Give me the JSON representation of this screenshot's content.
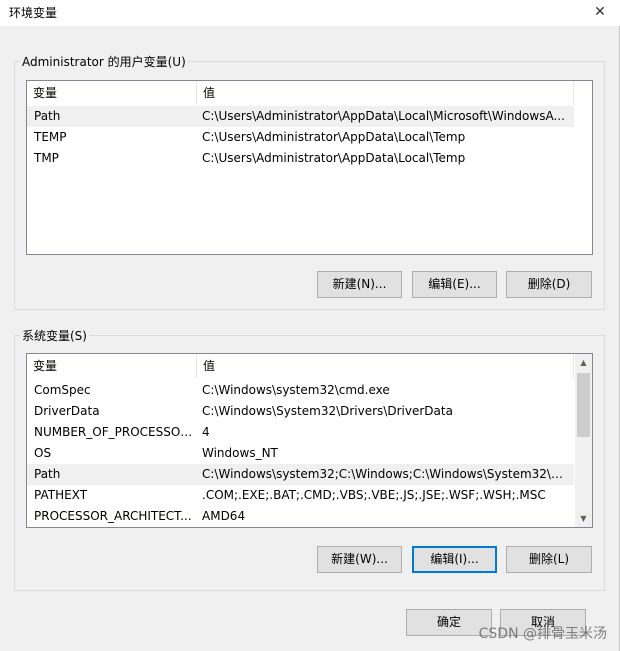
{
  "window": {
    "title": "环境变量",
    "close_glyph": "✕"
  },
  "user_vars": {
    "group_label": "Administrator 的用户变量(U)",
    "columns": [
      "变量",
      "值"
    ],
    "rows": [
      {
        "name": "Path",
        "value": "C:\\Users\\Administrator\\AppData\\Local\\Microsoft\\WindowsA..."
      },
      {
        "name": "TEMP",
        "value": "C:\\Users\\Administrator\\AppData\\Local\\Temp"
      },
      {
        "name": "TMP",
        "value": "C:\\Users\\Administrator\\AppData\\Local\\Temp"
      }
    ],
    "selected_row": "Path",
    "buttons": {
      "new": "新建(N)...",
      "edit": "编辑(E)...",
      "delete": "删除(D)"
    }
  },
  "system_vars": {
    "group_label": "系统变量(S)",
    "columns": [
      "变量",
      "值"
    ],
    "rows": [
      {
        "name": "ComSpec",
        "value": "C:\\Windows\\system32\\cmd.exe"
      },
      {
        "name": "DriverData",
        "value": "C:\\Windows\\System32\\Drivers\\DriverData"
      },
      {
        "name": "NUMBER_OF_PROCESSORS",
        "value": "4"
      },
      {
        "name": "OS",
        "value": "Windows_NT"
      },
      {
        "name": "Path",
        "value": "C:\\Windows\\system32;C:\\Windows;C:\\Windows\\System32\\Wb..."
      },
      {
        "name": "PATHEXT",
        "value": ".COM;.EXE;.BAT;.CMD;.VBS;.VBE;.JS;.JSE;.WSF;.WSH;.MSC"
      },
      {
        "name": "PROCESSOR_ARCHITECT...",
        "value": "AMD64"
      }
    ],
    "selected_row": "Path",
    "buttons": {
      "new": "新建(W)...",
      "edit": "编辑(I)...",
      "delete": "删除(L)"
    }
  },
  "footer": {
    "ok": "确定",
    "cancel": "取消"
  },
  "watermark": "CSDN @排骨玉米汤"
}
